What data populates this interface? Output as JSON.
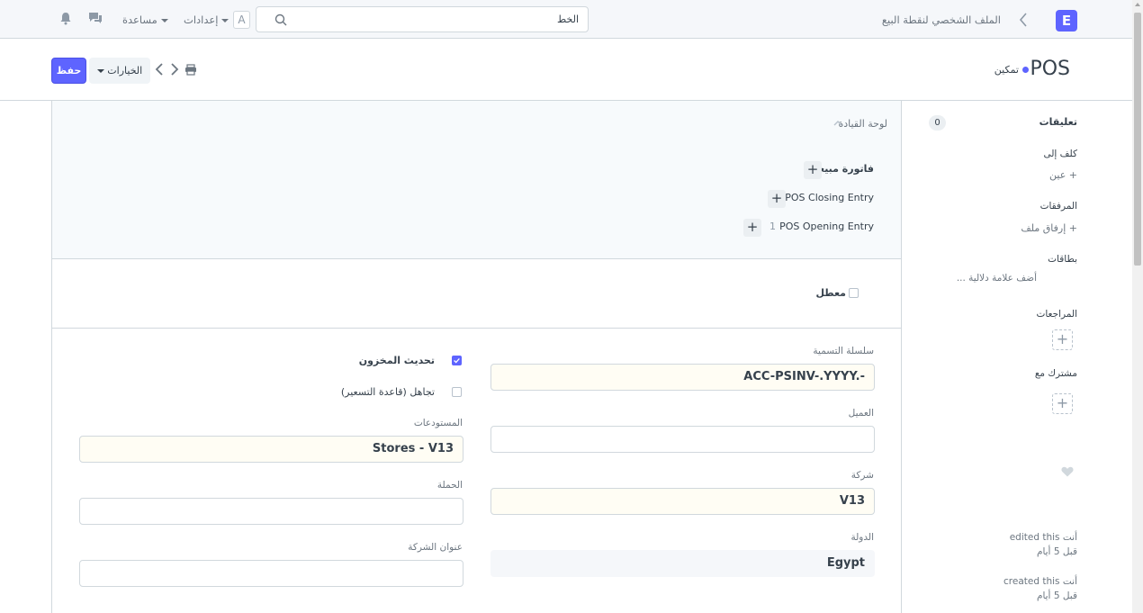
{
  "navbar": {
    "logo": "E",
    "breadcrumb": "الملف الشخصي لنقطة البيع",
    "search_value": "الخط",
    "avatar_letter": "A",
    "settings_label": "إعدادات",
    "help_label": "مساعدة"
  },
  "page_head": {
    "title": "POS",
    "status": "تمكين",
    "save_label": "حفظ",
    "menu_label": "الخيارات"
  },
  "dashboard": {
    "title": "لوحة القيادة",
    "links": [
      {
        "label": "فاتورة مبيعات",
        "count": ""
      },
      {
        "label": "POS Closing Entry",
        "count": ""
      },
      {
        "label": "POS Opening Entry",
        "count": "1"
      }
    ]
  },
  "disabled_field": {
    "label": "معطل",
    "checked": false
  },
  "form": {
    "naming_series": {
      "label": "سلسلة التسمية",
      "value": "ACC-PSINV-.YYYY.-"
    },
    "customer": {
      "label": "العميل",
      "value": ""
    },
    "company": {
      "label": "شركة",
      "value": "V13"
    },
    "country": {
      "label": "الدولة",
      "value": "Egypt"
    },
    "update_stock": {
      "label": "تحديث المخزون",
      "checked": true
    },
    "ignore_pricing_rule": {
      "label": "تجاهل (قاعدة التسعير)",
      "checked": false
    },
    "warehouse": {
      "label": "المستودعات",
      "value": "Stores - V13"
    },
    "campaign": {
      "label": "الحملة",
      "value": ""
    },
    "company_address": {
      "label": "عنوان الشركة",
      "value": ""
    }
  },
  "sidebar": {
    "comments_label": "تعليقات",
    "comments_count": "0",
    "assigned_label": "كلف إلى",
    "assign_link": "عين",
    "attachments_label": "المرفقات",
    "attach_link": "إرفاق ملف",
    "tags_label": "بطاقات",
    "tags_link": "أضف علامة دلالية ...",
    "reviews_label": "المراجعات",
    "shared_label": "مشترك مع",
    "activity": [
      {
        "who": "أنت",
        "action": "edited this",
        "when": "قبل 5 أيام"
      },
      {
        "who": "أنت",
        "action": "created this",
        "when": "قبل 5 أيام"
      }
    ]
  },
  "colors": {
    "primary": "#5e64ff",
    "required_bg": "#fffdf4",
    "border": "#d1d8dd"
  }
}
